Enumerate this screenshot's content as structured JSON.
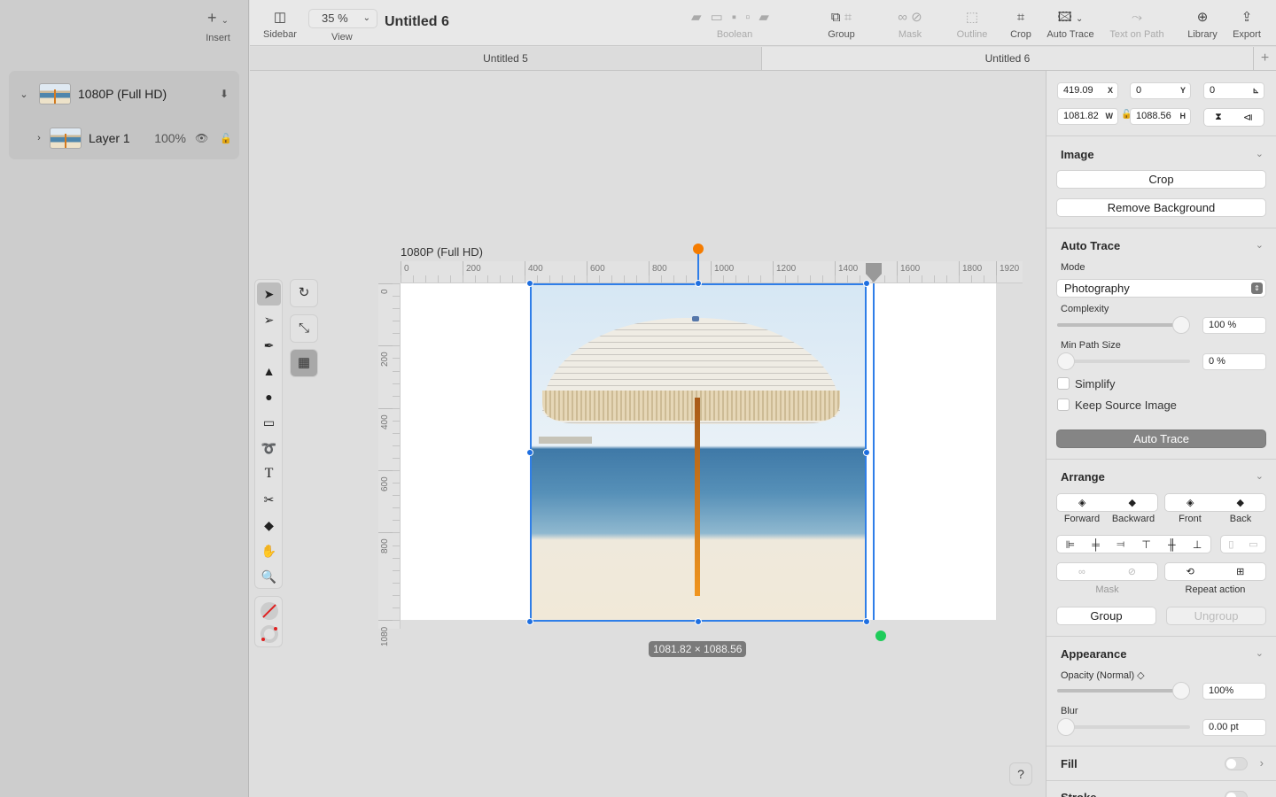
{
  "sidebar": {
    "insert_label": "Insert",
    "layers": [
      {
        "name": "1080P (Full HD)",
        "expanded": true
      },
      {
        "name": "Layer 1",
        "opacity": "100%",
        "expanded": false
      }
    ]
  },
  "toolbar": {
    "sidebar_label": "Sidebar",
    "zoom_value": "35 %",
    "view_label": "View",
    "doc_title": "Untitled 6",
    "boolean_label": "Boolean",
    "group_label": "Group",
    "mask_label": "Mask",
    "outline_label": "Outline",
    "crop_label": "Crop",
    "autotrace_label": "Auto Trace",
    "textonpath_label": "Text on Path",
    "library_label": "Library",
    "export_label": "Export"
  },
  "tabs": [
    {
      "label": "Untitled 5",
      "active": false
    },
    {
      "label": "Untitled 6",
      "active": true
    }
  ],
  "canvas": {
    "artboard_title": "1080P (Full HD)",
    "hruler_ticks": [
      "0",
      "200",
      "400",
      "600",
      "800",
      "1000",
      "1200",
      "1400",
      "1600",
      "1800",
      "1920"
    ],
    "vruler_ticks": [
      "0",
      "200",
      "400",
      "600",
      "800",
      "1080"
    ],
    "size_badge": "1081.82 × 1088.56",
    "help_label": "?"
  },
  "inspector": {
    "x": "419.09",
    "x_suffix": "X",
    "y": "0",
    "y_suffix": "Y",
    "angle": "0",
    "w": "1081.82",
    "w_suffix": "W",
    "h": "1088.56",
    "h_suffix": "H",
    "image": {
      "title": "Image",
      "crop_label": "Crop",
      "remove_bg_label": "Remove Background"
    },
    "autotrace": {
      "title": "Auto Trace",
      "mode_label": "Mode",
      "mode_value": "Photography",
      "complexity_label": "Complexity",
      "complexity_value": "100 %",
      "complexity_fraction": 1.0,
      "minpath_label": "Min Path Size",
      "minpath_value": "0 %",
      "minpath_fraction": 0.0,
      "simplify_label": "Simplify",
      "simplify_checked": false,
      "keep_source_label": "Keep Source Image",
      "keep_source_checked": false,
      "button_label": "Auto Trace"
    },
    "arrange": {
      "title": "Arrange",
      "forward_label": "Forward",
      "backward_label": "Backward",
      "front_label": "Front",
      "back_label": "Back",
      "mask_label": "Mask",
      "repeat_label": "Repeat action",
      "group_label": "Group",
      "ungroup_label": "Ungroup"
    },
    "appearance": {
      "title": "Appearance",
      "opacity_label": "Opacity (Normal) ◇",
      "opacity_value": "100%",
      "opacity_fraction": 1.0,
      "blur_label": "Blur",
      "blur_value": "0.00 pt",
      "blur_fraction": 0.0
    },
    "fill_title": "Fill",
    "stroke_title": "Stroke"
  },
  "colors": {
    "accent": "#2f7ee8",
    "rotate_handle": "#f57c00",
    "anchor_handle": "#1fcc5a"
  }
}
